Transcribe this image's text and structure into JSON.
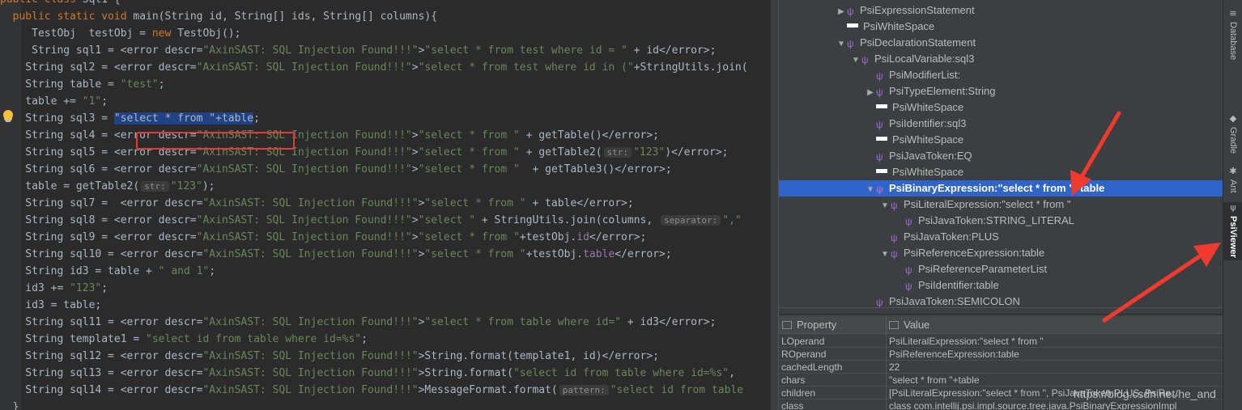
{
  "editor": {
    "lines": [
      {
        "parts": [
          [
            "kw",
            "public "
          ],
          [
            "kw",
            "class "
          ],
          [
            "ident",
            "Sql1 {"
          ]
        ]
      },
      {
        "parts": [
          [
            "kw",
            "  public static void "
          ],
          [
            "ident",
            "main(String id, String[] ids, String[] columns){"
          ]
        ]
      },
      {
        "parts": [
          [
            "ident",
            "     TestObj  testObj = "
          ],
          [
            "kw",
            "new "
          ],
          [
            "ident",
            "TestObj();"
          ]
        ]
      },
      {
        "parts": [
          [
            "ident",
            "     String sql1 = <error descr="
          ],
          [
            "str",
            "\"AxinSAST: SQL Injection Found!!!\""
          ],
          [
            "ident",
            ">"
          ],
          [
            "str",
            "\"select * from test where id = \" "
          ],
          [
            "ident",
            "+ id</error>;"
          ]
        ]
      },
      {
        "parts": [
          [
            "ident",
            "    String sql2 = <error descr="
          ],
          [
            "str",
            "\"AxinSAST: SQL Injection Found!!!\""
          ],
          [
            "ident",
            ">"
          ],
          [
            "str",
            "\"select * from test where id in (\""
          ],
          [
            "ident",
            "+StringUtils.join("
          ]
        ]
      },
      {
        "parts": [
          [
            "ident",
            "    String table = "
          ],
          [
            "str",
            "\"test\""
          ],
          [
            "ident",
            ";"
          ]
        ]
      },
      {
        "parts": [
          [
            "ident",
            "    table += "
          ],
          [
            "str",
            "\"1\""
          ],
          [
            "ident",
            ";"
          ]
        ]
      },
      {
        "parts": [
          [
            "ident",
            "    String sql3 = "
          ],
          [
            "sel",
            "\"select * from \"+table"
          ],
          [
            "ident",
            ";"
          ]
        ]
      },
      {
        "parts": [
          [
            "ident",
            "    String sql4 = <error descr="
          ],
          [
            "str",
            "\"AxinSAST: SQL Injection Found!!!\""
          ],
          [
            "ident",
            ">"
          ],
          [
            "str",
            "\"select * from \" "
          ],
          [
            "ident",
            "+ getTable()</error>;"
          ]
        ]
      },
      {
        "parts": [
          [
            "ident",
            "    String sql5 = <error descr="
          ],
          [
            "str",
            "\"AxinSAST: SQL Injection Found!!!\""
          ],
          [
            "ident",
            ">"
          ],
          [
            "str",
            "\"select * from \" "
          ],
          [
            "ident",
            "+ getTable2("
          ],
          [
            "hint",
            "str:"
          ],
          [
            "str",
            "\"123\""
          ],
          [
            "ident",
            ")</error>;"
          ]
        ]
      },
      {
        "parts": [
          [
            "ident",
            "    String sql6 = <error descr="
          ],
          [
            "str",
            "\"AxinSAST: SQL Injection Found!!!\""
          ],
          [
            "ident",
            ">"
          ],
          [
            "str",
            "\"select * from \"  "
          ],
          [
            "ident",
            "+ getTable3()</error>;"
          ]
        ]
      },
      {
        "parts": [
          [
            "ident",
            "    table = getTable2("
          ],
          [
            "hint",
            "str:"
          ],
          [
            "str",
            "\"123\""
          ],
          [
            "ident",
            ");"
          ]
        ]
      },
      {
        "parts": [
          [
            "ident",
            "    String sql7 =  <error descr="
          ],
          [
            "str",
            "\"AxinSAST: SQL Injection Found!!!\""
          ],
          [
            "ident",
            ">"
          ],
          [
            "str",
            "\"select * from \" "
          ],
          [
            "ident",
            "+ table</error>;"
          ]
        ]
      },
      {
        "parts": [
          [
            "ident",
            "    String sql8 = <error descr="
          ],
          [
            "str",
            "\"AxinSAST: SQL Injection Found!!!\""
          ],
          [
            "ident",
            ">"
          ],
          [
            "str",
            "\"select \" "
          ],
          [
            "ident",
            "+ StringUtils.join(columns, "
          ],
          [
            "hint",
            "separator:"
          ],
          [
            "str",
            "\",\""
          ]
        ]
      },
      {
        "parts": [
          [
            "ident",
            "    String sql9 = <error descr="
          ],
          [
            "str",
            "\"AxinSAST: SQL Injection Found!!!\""
          ],
          [
            "ident",
            ">"
          ],
          [
            "str",
            "\"select * from \""
          ],
          [
            "ident",
            "+testObj."
          ],
          [
            "field",
            "id"
          ],
          [
            "ident",
            "</error>;"
          ]
        ]
      },
      {
        "parts": [
          [
            "ident",
            "    String sql10 = <error descr="
          ],
          [
            "str",
            "\"AxinSAST: SQL Injection Found!!!\""
          ],
          [
            "ident",
            ">"
          ],
          [
            "str",
            "\"select * from \""
          ],
          [
            "ident",
            "+testObj."
          ],
          [
            "field",
            "table"
          ],
          [
            "ident",
            "</error>;"
          ]
        ]
      },
      {
        "parts": [
          [
            "ident",
            "    String id3 = table + "
          ],
          [
            "str",
            "\" and 1\""
          ],
          [
            "ident",
            ";"
          ]
        ]
      },
      {
        "parts": [
          [
            "ident",
            "    id3 += "
          ],
          [
            "str",
            "\"123\""
          ],
          [
            "ident",
            ";"
          ]
        ]
      },
      {
        "parts": [
          [
            "ident",
            "    id3 = table;"
          ]
        ]
      },
      {
        "parts": [
          [
            "ident",
            "    String sql11 = <error descr="
          ],
          [
            "str",
            "\"AxinSAST: SQL Injection Found!!!\""
          ],
          [
            "ident",
            ">"
          ],
          [
            "str",
            "\"select * from table where id=\" "
          ],
          [
            "ident",
            "+ id3</error>;"
          ]
        ]
      },
      {
        "parts": [
          [
            "ident",
            "    String template1 = "
          ],
          [
            "str",
            "\"select id from table where id=%s\""
          ],
          [
            "ident",
            ";"
          ]
        ]
      },
      {
        "parts": [
          [
            "ident",
            "    String sql12 = <error descr="
          ],
          [
            "str",
            "\"AxinSAST: SQL Injection Found!!!\""
          ],
          [
            "ident",
            ">String.format(template1, id)</error>;"
          ]
        ]
      },
      {
        "parts": [
          [
            "ident",
            "    String sql13 = <error descr="
          ],
          [
            "str",
            "\"AxinSAST: SQL Injection Found!!!\""
          ],
          [
            "ident",
            ">String.format("
          ],
          [
            "str",
            "\"select id from table where id=%s\""
          ],
          [
            "ident",
            ","
          ]
        ]
      },
      {
        "parts": [
          [
            "ident",
            "    String sql14 = <error descr="
          ],
          [
            "str",
            "\"AxinSAST: SQL Injection Found!!!\""
          ],
          [
            "ident",
            ">MessageFormat.format("
          ],
          [
            "hint",
            "pattern:"
          ],
          [
            "str",
            "\"select id from table"
          ]
        ]
      },
      {
        "parts": [
          [
            "ident",
            "  }"
          ]
        ]
      }
    ]
  },
  "tree": {
    "rows": [
      {
        "indent": 4,
        "arrow": "right",
        "icon": "psi",
        "label": "PsiExpressionStatement"
      },
      {
        "indent": 4,
        "arrow": "none",
        "icon": "ws",
        "label": "PsiWhiteSpace"
      },
      {
        "indent": 4,
        "arrow": "down",
        "icon": "psi",
        "label": "PsiDeclarationStatement"
      },
      {
        "indent": 5,
        "arrow": "down",
        "icon": "psi",
        "label": "PsiLocalVariable:sql3"
      },
      {
        "indent": 6,
        "arrow": "none",
        "icon": "psi",
        "label": "PsiModifierList:"
      },
      {
        "indent": 6,
        "arrow": "right",
        "icon": "psi",
        "label": "PsiTypeElement:String"
      },
      {
        "indent": 6,
        "arrow": "none",
        "icon": "ws",
        "label": "PsiWhiteSpace"
      },
      {
        "indent": 6,
        "arrow": "none",
        "icon": "psi",
        "label": "PsiIdentifier:sql3"
      },
      {
        "indent": 6,
        "arrow": "none",
        "icon": "ws",
        "label": "PsiWhiteSpace"
      },
      {
        "indent": 6,
        "arrow": "none",
        "icon": "psi",
        "label": "PsiJavaToken:EQ"
      },
      {
        "indent": 6,
        "arrow": "none",
        "icon": "ws",
        "label": "PsiWhiteSpace"
      },
      {
        "indent": 6,
        "arrow": "down",
        "icon": "psi",
        "label": "PsiBinaryExpression:\"select * from \"+table",
        "selected": true
      },
      {
        "indent": 7,
        "arrow": "down",
        "icon": "psi",
        "label": "PsiLiteralExpression:\"select * from \""
      },
      {
        "indent": 8,
        "arrow": "none",
        "icon": "psi",
        "label": "PsiJavaToken:STRING_LITERAL"
      },
      {
        "indent": 7,
        "arrow": "none",
        "icon": "psi",
        "label": "PsiJavaToken:PLUS"
      },
      {
        "indent": 7,
        "arrow": "down",
        "icon": "psi",
        "label": "PsiReferenceExpression:table"
      },
      {
        "indent": 8,
        "arrow": "none",
        "icon": "psi",
        "label": "PsiReferenceParameterList"
      },
      {
        "indent": 8,
        "arrow": "none",
        "icon": "psi",
        "label": "PsiIdentifier:table"
      },
      {
        "indent": 6,
        "arrow": "none",
        "icon": "psi",
        "label": "PsiJavaToken:SEMICOLON"
      }
    ]
  },
  "props": {
    "header": {
      "property": "Property",
      "value": "Value"
    },
    "rows": [
      {
        "name": "LOperand",
        "value": "PsiLiteralExpression:\"select * from \""
      },
      {
        "name": "ROperand",
        "value": "PsiReferenceExpression:table"
      },
      {
        "name": "cachedLength",
        "value": "22"
      },
      {
        "name": "chars",
        "value": "\"select * from \"+table"
      },
      {
        "name": "children",
        "value": "[PsiLiteralExpression:\"select * from \", PsiJavaToken:PLUS, PsiRe..."
      },
      {
        "name": "class",
        "value": "class com.intellij.psi.impl.source.tree.java.PsiBinaryExpressionImpl"
      }
    ]
  },
  "sidebar": {
    "tabs": [
      {
        "label": "Database",
        "icon": "≡"
      },
      {
        "label": "Gradle",
        "icon": "◆"
      },
      {
        "label": "Ant",
        "icon": "✱"
      },
      {
        "label": "PsiViewer",
        "icon": "ψ",
        "active": true
      }
    ]
  },
  "watermark": "https://blog.csdn.net/he_and",
  "colors": {
    "selection": "#2f65ca",
    "highlight_box": "#e53935",
    "arrow": "#f03a2e"
  }
}
